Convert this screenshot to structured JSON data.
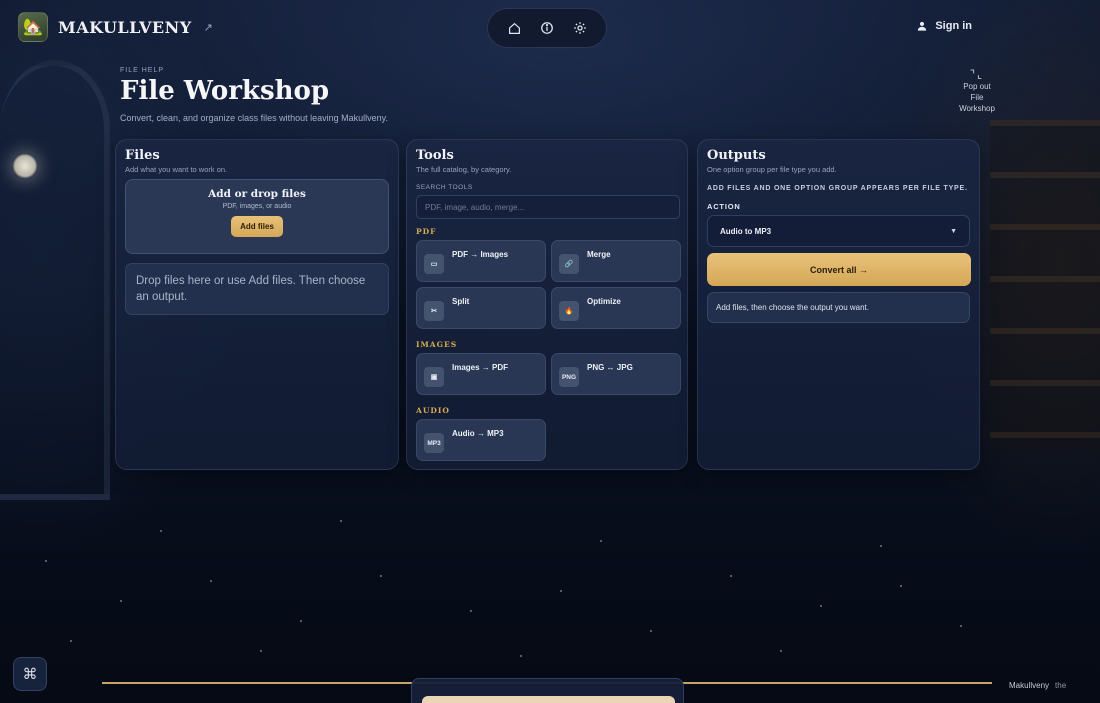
{
  "app": {
    "name": "MAKULLVENY",
    "ext_icon": "external-link-icon",
    "logo_icon": "house-landscape-icon"
  },
  "topnav": {
    "icons": [
      "home-icon",
      "info-icon",
      "gear-icon"
    ]
  },
  "signin": {
    "label": "Sign in",
    "icon": "user-icon"
  },
  "header": {
    "eyebrow": "FILE HELP",
    "title": "File Workshop",
    "subtitle": "Convert, clean, and organize class files without leaving Makullveny."
  },
  "popout": {
    "line1": "Pop out",
    "line2": "File",
    "line3": "Workshop"
  },
  "files": {
    "title": "Files",
    "subtitle": "Add what you want to work on.",
    "dropzone_title": "Add or drop files",
    "dropzone_sub": "PDF, images, or audio",
    "add_button": "Add files",
    "hint": "Drop files here or use Add files. Then choose an output."
  },
  "tools": {
    "title": "Tools",
    "subtitle": "The full catalog, by category.",
    "search_label": "SEARCH TOOLS",
    "search_placeholder": "PDF, image, audio, merge...",
    "categories": [
      {
        "label": "PDF",
        "items": [
          {
            "name": "PDF → Images",
            "icon_text": "▭",
            "icon": "image-icon"
          },
          {
            "name": "Merge",
            "icon_text": "🔗",
            "icon": "link-icon"
          },
          {
            "name": "Split",
            "icon_text": "✂",
            "icon": "scissors-icon"
          },
          {
            "name": "Optimize",
            "icon_text": "🔥",
            "icon": "flame-icon"
          }
        ]
      },
      {
        "label": "IMAGES",
        "items": [
          {
            "name": "Images → PDF",
            "icon_text": "▣",
            "icon": "document-icon"
          },
          {
            "name": "PNG ↔ JPG",
            "icon_text": "PNG",
            "icon": "png-icon"
          }
        ]
      },
      {
        "label": "AUDIO",
        "items": [
          {
            "name": "Audio → MP3",
            "icon_text": "MP3",
            "icon": "mp3-icon"
          }
        ]
      }
    ]
  },
  "outputs": {
    "title": "Outputs",
    "subtitle": "One option group per file type you add.",
    "note": "ADD FILES AND ONE OPTION GROUP APPEARS PER FILE TYPE.",
    "action_label": "ACTION",
    "action_value": "Audio to MP3",
    "convert_button": "Convert all →",
    "status": "Add files, then choose the output you want."
  },
  "footer": {
    "brand": "Makullveny",
    "mark": "the",
    "command_icon": "command-icon"
  },
  "colors": {
    "accent_gold": "#d9ab55",
    "button_gold": "#e3b96c",
    "panel_bg": "#1a2642",
    "page_bg": "#0b1426"
  }
}
